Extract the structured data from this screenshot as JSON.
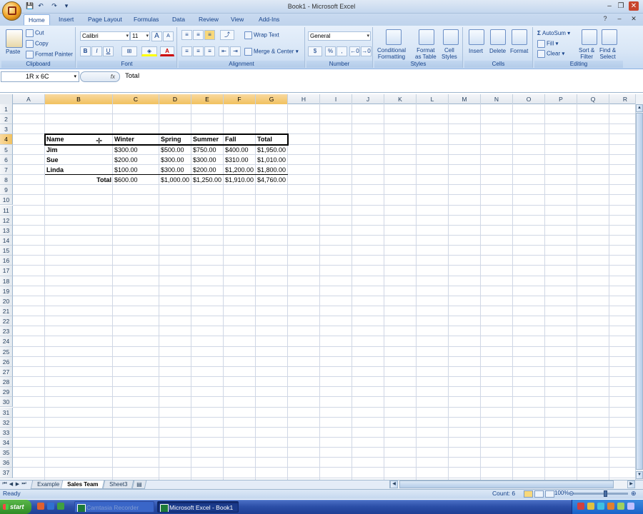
{
  "window": {
    "title": "Book1 - Microsoft Excel",
    "minimize": "–",
    "restore": "❐",
    "close": "✕",
    "help": "?",
    "wmin": "–",
    "wclose": "✕"
  },
  "quick_access": [
    "💾",
    "↶",
    "↷",
    "▾"
  ],
  "tabs": [
    "Home",
    "Insert",
    "Page Layout",
    "Formulas",
    "Data",
    "Review",
    "View",
    "Add-Ins"
  ],
  "ribbon": {
    "clipboard": {
      "label": "Clipboard",
      "paste": "Paste",
      "cut": "Cut",
      "copy": "Copy",
      "format_painter": "Format Painter"
    },
    "font": {
      "label": "Font",
      "name": "Calibri",
      "size": "11",
      "grow": "A",
      "shrink": "A",
      "bold": "B",
      "italic": "I",
      "underline": "U"
    },
    "alignment": {
      "label": "Alignment",
      "wrap": "Wrap Text",
      "merge": "Merge & Center"
    },
    "number": {
      "label": "Number",
      "format": "General",
      "currency": "$",
      "percent": "%",
      "comma": ","
    },
    "styles": {
      "label": "Styles",
      "conditional": "Conditional\nFormatting",
      "format_table": "Format\nas Table",
      "cell_styles": "Cell\nStyles"
    },
    "cells": {
      "label": "Cells",
      "insert": "Insert",
      "delete": "Delete",
      "format": "Format"
    },
    "editing": {
      "label": "Editing",
      "autosum": "AutoSum",
      "fill": "Fill",
      "clear": "Clear",
      "sort": "Sort &\nFilter",
      "find": "Find &\nSelect"
    }
  },
  "formula_bar": {
    "name_box": "1R x 6C",
    "fx": "fx",
    "content": "Total"
  },
  "columns": [
    "A",
    "B",
    "C",
    "D",
    "E",
    "F",
    "G",
    "H",
    "I",
    "J",
    "K",
    "L",
    "M",
    "N",
    "O",
    "P",
    "Q",
    "R"
  ],
  "rows": [
    "1",
    "2",
    "3",
    "4",
    "5",
    "6",
    "7",
    "8",
    "9",
    "10",
    "11",
    "12",
    "13",
    "14",
    "15",
    "16",
    "17",
    "18",
    "19",
    "20",
    "21",
    "22",
    "23",
    "24",
    "25",
    "26",
    "27",
    "28",
    "29",
    "30",
    "31",
    "32",
    "33",
    "34",
    "35",
    "36",
    "37"
  ],
  "table": {
    "headers": [
      "Name",
      "Winter",
      "Spring",
      "Summer",
      "Fall",
      "Total"
    ],
    "rows": [
      [
        "Jim",
        "$300.00",
        "$500.00",
        "$750.00",
        "$400.00",
        "$1,950.00"
      ],
      [
        "Sue",
        "$200.00",
        "$300.00",
        "$300.00",
        "$310.00",
        "$1,010.00"
      ],
      [
        "Linda",
        "$100.00",
        "$300.00",
        "$200.00",
        "$1,200.00",
        "$1,800.00"
      ]
    ],
    "total_row": [
      "Total",
      "$600.00",
      "$1,000.00",
      "$1,250.00",
      "$1,910.00",
      "$4,760.00"
    ]
  },
  "sheets": [
    "Example",
    "Sales Team",
    "Sheet3"
  ],
  "status": {
    "ready": "Ready",
    "count": "Count: 6",
    "zoom": "100%"
  },
  "taskbar": {
    "start": "start",
    "items": [
      "Camtasia Recorder",
      "Microsoft Excel - Book1"
    ]
  },
  "colors": {
    "ribbon_blue": "#15428b",
    "selection_header": "#f1c15f",
    "taskbar": "#2c4fa8"
  }
}
